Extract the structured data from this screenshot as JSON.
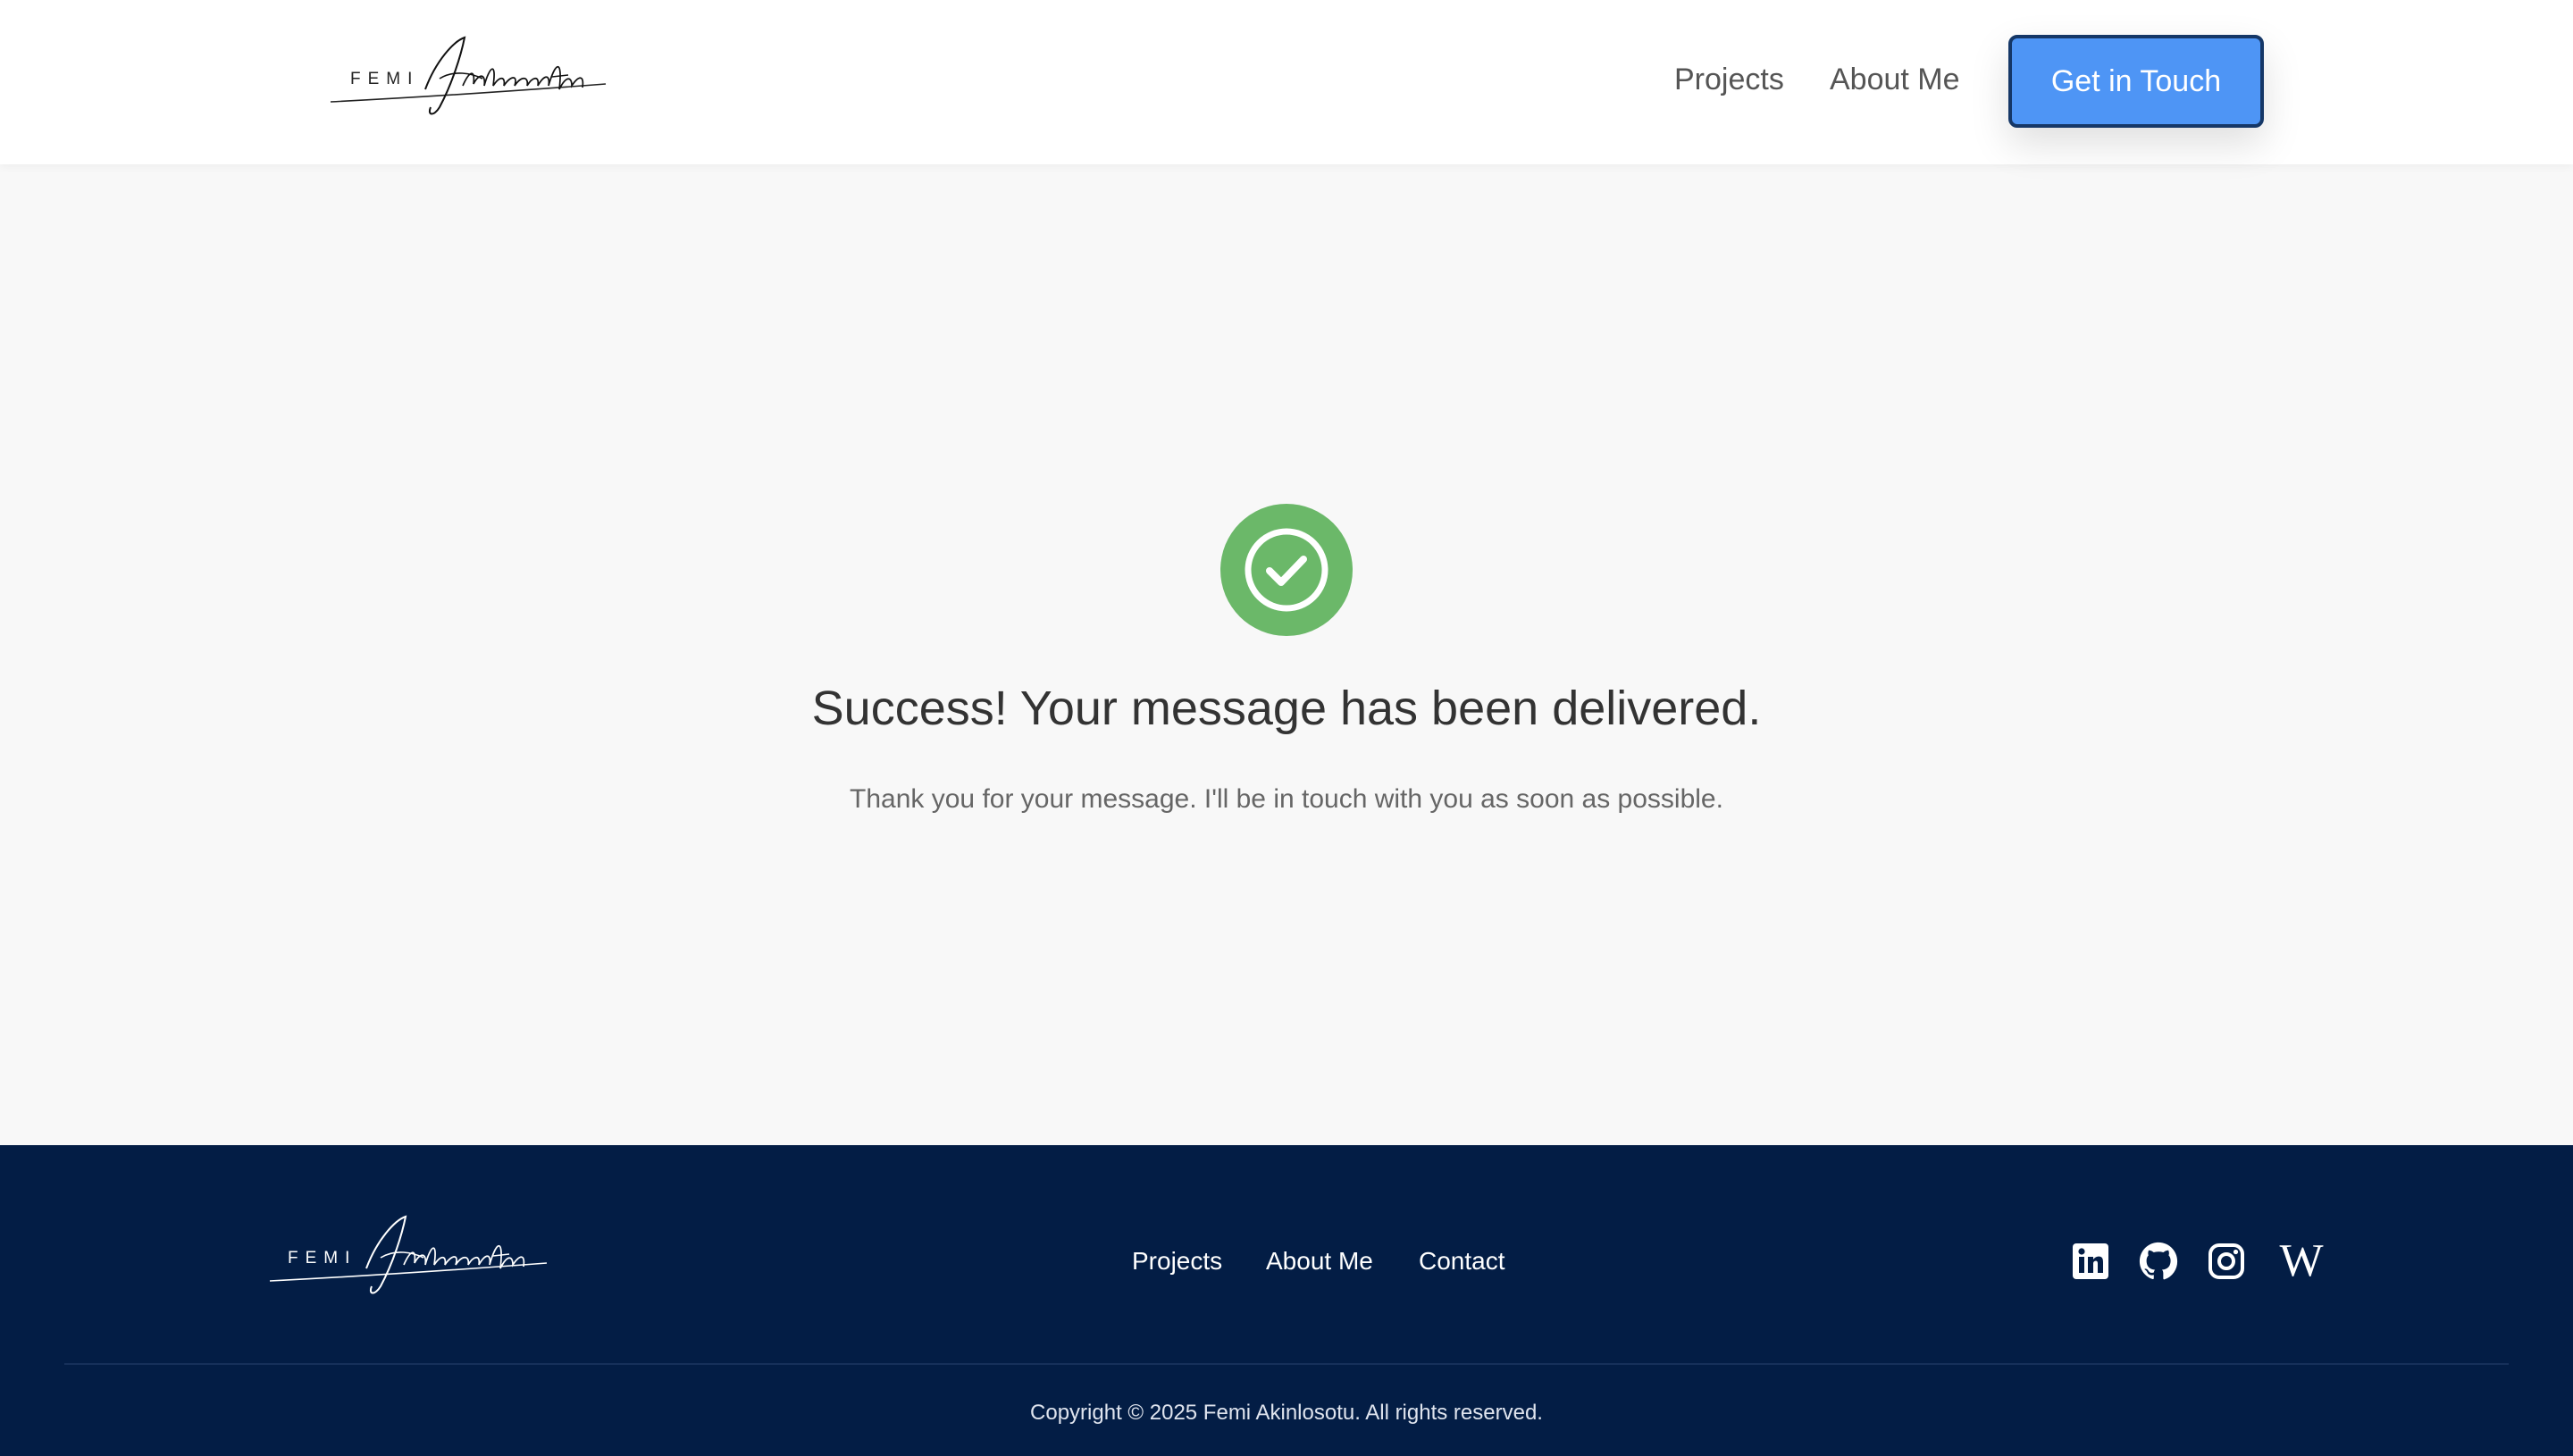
{
  "header": {
    "logo_first": "FEMI",
    "logo_last": "Akinlosotu",
    "nav": {
      "projects": "Projects",
      "about": "About Me",
      "cta": "Get in Touch"
    }
  },
  "main": {
    "icon": "check-circle-icon",
    "title": "Success! Your message has been delivered.",
    "message": "Thank you for your message. I'll be in touch with you as soon as possible."
  },
  "footer": {
    "logo_first": "FEMI",
    "logo_last": "Akinlosotu",
    "nav": {
      "projects": "Projects",
      "about": "About Me",
      "contact": "Contact"
    },
    "social": {
      "linkedin": "linkedin-icon",
      "github": "github-icon",
      "instagram": "instagram-icon",
      "wikipedia": "W"
    },
    "copyright": "Copyright © 2025 Femi Akinlosotu. All rights reserved."
  },
  "colors": {
    "accent": "#4e95f5",
    "accent_border": "#153767",
    "success": "#6bb869",
    "footer_bg": "#031d45",
    "page_bg": "#f8f8f8"
  }
}
